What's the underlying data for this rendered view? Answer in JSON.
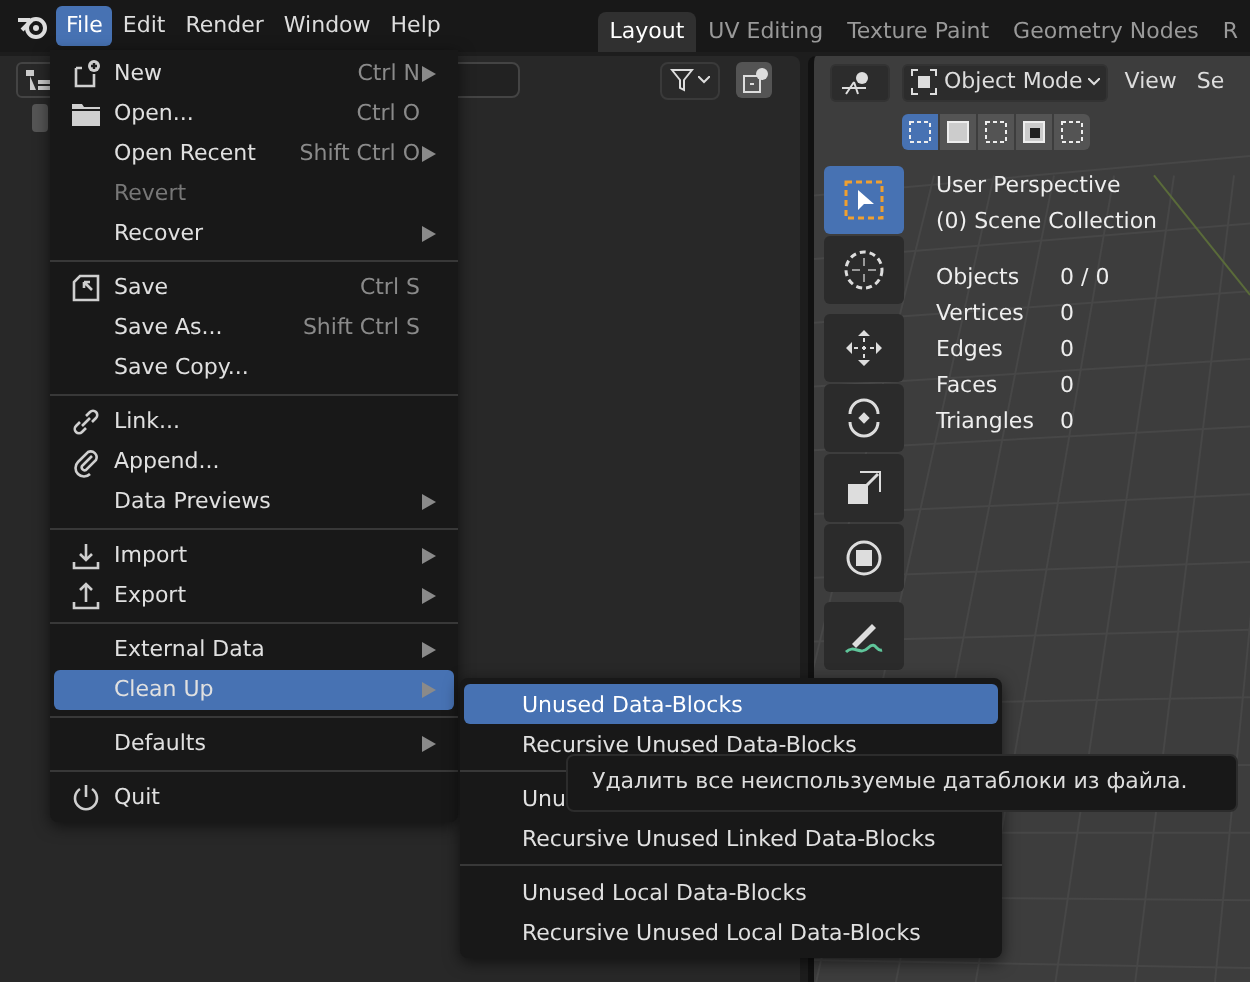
{
  "menubar": [
    {
      "label": "File",
      "selected": true
    },
    {
      "label": "Edit",
      "selected": false
    },
    {
      "label": "Render",
      "selected": false
    },
    {
      "label": "Window",
      "selected": false
    },
    {
      "label": "Help",
      "selected": false
    }
  ],
  "workspace_tabs": [
    {
      "label": "Layout",
      "selected": true
    },
    {
      "label": "UV Editing",
      "selected": false
    },
    {
      "label": "Texture Paint",
      "selected": false
    },
    {
      "label": "Geometry Nodes",
      "selected": false
    },
    {
      "label": "R",
      "selected": false
    }
  ],
  "viewport_header": {
    "mode": "Object Mode",
    "menus": [
      "View",
      "Se"
    ]
  },
  "select_modes": [
    {
      "selected": true
    },
    {
      "selected": false
    },
    {
      "selected": false
    },
    {
      "selected": false
    },
    {
      "selected": false
    }
  ],
  "toolbar": [
    {
      "selected": true
    },
    {
      "selected": false
    },
    {
      "selected": false
    },
    {
      "selected": false
    },
    {
      "selected": false
    },
    {
      "selected": false
    },
    {
      "selected": false
    }
  ],
  "overlay": {
    "view": "User Perspective",
    "collection": "(0) Scene Collection",
    "stats": [
      {
        "label": "Objects",
        "value": "0 / 0"
      },
      {
        "label": "Vertices",
        "value": "0"
      },
      {
        "label": "Edges",
        "value": "0"
      },
      {
        "label": "Faces",
        "value": "0"
      },
      {
        "label": "Triangles",
        "value": "0"
      }
    ]
  },
  "file_menu": {
    "groups": [
      [
        {
          "label": "New",
          "shortcut": "Ctrl N",
          "submenu": true,
          "disabled": false,
          "selected": false
        },
        {
          "label": "Open...",
          "shortcut": "Ctrl O",
          "submenu": false,
          "disabled": false,
          "selected": false
        },
        {
          "label": "Open Recent",
          "shortcut": "Shift Ctrl O",
          "submenu": true,
          "disabled": false,
          "selected": false
        },
        {
          "label": "Revert",
          "submenu": false,
          "disabled": true,
          "selected": false
        },
        {
          "label": "Recover",
          "submenu": true,
          "disabled": false,
          "selected": false
        }
      ],
      [
        {
          "label": "Save",
          "shortcut": "Ctrl S",
          "submenu": false,
          "disabled": false,
          "selected": false
        },
        {
          "label": "Save As...",
          "shortcut": "Shift Ctrl S",
          "submenu": false,
          "disabled": false,
          "selected": false
        },
        {
          "label": "Save Copy...",
          "submenu": false,
          "disabled": false,
          "selected": false
        }
      ],
      [
        {
          "label": "Link...",
          "submenu": false,
          "disabled": false,
          "selected": false
        },
        {
          "label": "Append...",
          "submenu": false,
          "disabled": false,
          "selected": false
        },
        {
          "label": "Data Previews",
          "submenu": true,
          "disabled": false,
          "selected": false
        }
      ],
      [
        {
          "label": "Import",
          "submenu": true,
          "disabled": false,
          "selected": false
        },
        {
          "label": "Export",
          "submenu": true,
          "disabled": false,
          "selected": false
        }
      ],
      [
        {
          "label": "External Data",
          "submenu": true,
          "disabled": false,
          "selected": false
        },
        {
          "label": "Clean Up",
          "submenu": true,
          "disabled": false,
          "selected": true
        }
      ],
      [
        {
          "label": "Defaults",
          "submenu": true,
          "disabled": false,
          "selected": false
        }
      ],
      [
        {
          "label": "Quit",
          "submenu": false,
          "disabled": false,
          "selected": false
        }
      ]
    ]
  },
  "cleanup_menu": {
    "groups": [
      [
        {
          "label": "Unused Data-Blocks",
          "selected": true
        },
        {
          "label": "Recursive Unused Data-Blocks",
          "selected": false
        }
      ],
      [
        {
          "label": "Unu",
          "selected": false
        },
        {
          "label": "Recursive Unused Linked Data-Blocks",
          "selected": false
        }
      ],
      [
        {
          "label": "Unused Local Data-Blocks",
          "selected": false
        },
        {
          "label": "Recursive Unused Local Data-Blocks",
          "selected": false
        }
      ]
    ]
  },
  "tooltip": "Удалить все неиспользуемые датаблоки из файла."
}
